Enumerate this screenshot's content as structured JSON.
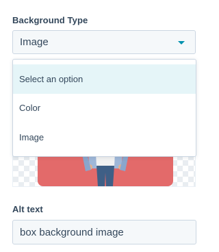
{
  "background_type": {
    "label": "Background Type",
    "selected_value": "Image",
    "caret_icon": "caret-down-icon",
    "accent_color": "#0091ae",
    "options": [
      {
        "label": "Select an option",
        "highlighted": true
      },
      {
        "label": "Color",
        "highlighted": false
      },
      {
        "label": "Image",
        "highlighted": false
      }
    ]
  },
  "preview": {
    "image_color": "#e36a6a"
  },
  "alt_text": {
    "label": "Alt text",
    "value": "box background image"
  }
}
